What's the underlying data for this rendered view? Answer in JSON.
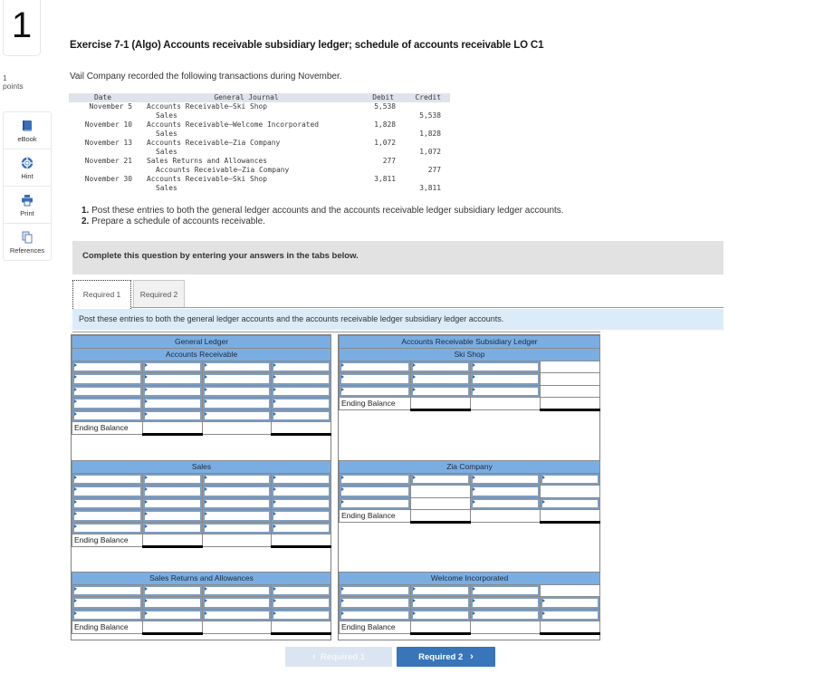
{
  "question": {
    "number": "1",
    "points_value": "1",
    "points_label": "points"
  },
  "sidebar": {
    "items": [
      {
        "label": "eBook",
        "icon": "book-icon"
      },
      {
        "label": "Hint",
        "icon": "lifebuoy-icon"
      },
      {
        "label": "Print",
        "icon": "printer-icon"
      },
      {
        "label": "References",
        "icon": "documents-icon"
      }
    ]
  },
  "title": "Exercise 7-1 (Algo) Accounts receivable subsidiary ledger; schedule of accounts receivable LO C1",
  "intro": "Vail Company recorded the following transactions during November.",
  "journal": {
    "headers": {
      "date": "Date",
      "account": "General Journal",
      "debit": "Debit",
      "credit": "Credit"
    },
    "rows": [
      {
        "date": "November 5",
        "account": "Accounts Receivable—Ski Shop",
        "indent": false,
        "debit": "5,538",
        "credit": ""
      },
      {
        "date": "",
        "account": "Sales",
        "indent": true,
        "debit": "",
        "credit": "5,538"
      },
      {
        "date": "November 10",
        "account": "Accounts Receivable—Welcome Incorporated",
        "indent": false,
        "debit": "1,828",
        "credit": ""
      },
      {
        "date": "",
        "account": "Sales",
        "indent": true,
        "debit": "",
        "credit": "1,828"
      },
      {
        "date": "November 13",
        "account": "Accounts Receivable—Zia Company",
        "indent": false,
        "debit": "1,072",
        "credit": ""
      },
      {
        "date": "",
        "account": "Sales",
        "indent": true,
        "debit": "",
        "credit": "1,072"
      },
      {
        "date": "November 21",
        "account": "Sales Returns and Allowances",
        "indent": false,
        "debit": "277",
        "credit": ""
      },
      {
        "date": "",
        "account": "Accounts Receivable—Zia Company",
        "indent": true,
        "debit": "",
        "credit": "277"
      },
      {
        "date": "November 30",
        "account": "Accounts Receivable—Ski Shop",
        "indent": false,
        "debit": "3,811",
        "credit": ""
      },
      {
        "date": "",
        "account": "Sales",
        "indent": true,
        "debit": "",
        "credit": "3,811"
      }
    ]
  },
  "instructions": [
    {
      "num": "1.",
      "text": " Post these entries to both the general ledger accounts and the accounts receivable ledger subsidiary ledger accounts."
    },
    {
      "num": "2.",
      "text": " Prepare a schedule of accounts receivable."
    }
  ],
  "banner": "Complete this question by entering your answers in the tabs below.",
  "tabs": [
    {
      "label": "Required 1",
      "active": true
    },
    {
      "label": "Required 2",
      "active": false
    }
  ],
  "tab_instruction": "Post these entries to both the general ledger accounts and the accounts receivable ledger subsidiary ledger accounts.",
  "ledgers": {
    "ending_balance_label": "Ending Balance",
    "left": [
      {
        "id": "accounts-receivable",
        "headers": [
          "General Ledger",
          "Accounts Receivable"
        ],
        "rows": [
          [
            "input",
            "input",
            "input",
            "input"
          ],
          [
            "input",
            "input",
            "input",
            "input"
          ],
          [
            "input",
            "input",
            "input",
            "input"
          ],
          [
            "input",
            "input",
            "input",
            "input"
          ],
          [
            "input",
            "input",
            "input",
            "input"
          ]
        ]
      },
      {
        "id": "sales",
        "headers": [
          "Sales"
        ],
        "rows": [
          [
            "input",
            "input",
            "input",
            "input"
          ],
          [
            "input",
            "input",
            "input",
            "input"
          ],
          [
            "input",
            "input",
            "input",
            "input"
          ],
          [
            "input",
            "input",
            "input",
            "input"
          ],
          [
            "input",
            "input",
            "input",
            "input"
          ]
        ]
      },
      {
        "id": "sales-returns-allowances",
        "headers": [
          "Sales Returns and Allowances"
        ],
        "rows": [
          [
            "input",
            "input",
            "input",
            "input"
          ],
          [
            "input",
            "input",
            "input",
            "input"
          ],
          [
            "input",
            "input",
            "input",
            "input"
          ]
        ]
      }
    ],
    "right": [
      {
        "id": "ski-shop",
        "headers": [
          "Accounts Receivable Subsidiary Ledger",
          "Ski Shop"
        ],
        "rows": [
          [
            "input",
            "input",
            "input",
            "static"
          ],
          [
            "input",
            "input",
            "input",
            "static"
          ],
          [
            "input",
            "input",
            "input",
            "static"
          ]
        ]
      },
      {
        "id": "zia-company",
        "headers": [
          "Zia Company"
        ],
        "rows": [
          [
            "input",
            "input",
            "input",
            "input"
          ],
          [
            "input",
            "static",
            "input",
            "static"
          ],
          [
            "input",
            "static",
            "input",
            "input"
          ]
        ]
      },
      {
        "id": "welcome-incorporated",
        "headers": [
          "Welcome Incorporated"
        ],
        "rows": [
          [
            "input",
            "input",
            "input",
            "static"
          ],
          [
            "input",
            "input",
            "input",
            "input"
          ],
          [
            "input",
            "input",
            "input",
            "input"
          ]
        ]
      }
    ]
  },
  "nav": {
    "prev_label": "Required 1",
    "prev_enabled": false,
    "next_label": "Required 2",
    "next_enabled": true
  },
  "colors": {
    "accent": "#3875b9",
    "ledger_header": "#7aaee3",
    "tab_bar": "#dcebf8",
    "banner": "#e2e2e2",
    "disabled_button": "#dbe5f1"
  }
}
